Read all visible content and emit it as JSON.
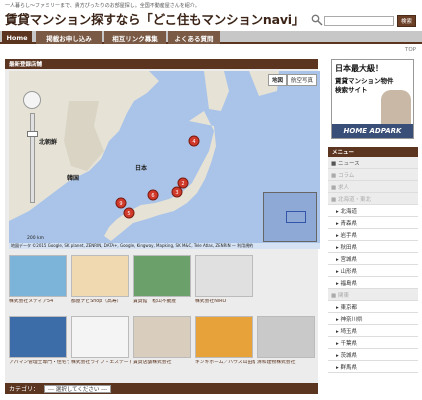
{
  "header": {
    "tagline": "一人暮らし〜ファミリーまで、貴方ぴったりのお部屋探し。全国不動産屋さんを紹介。",
    "title": "賃貸マンション探すなら「どこ住もマンションnavi」",
    "search_placeholder": "",
    "search_button": "検索"
  },
  "nav": {
    "items": [
      {
        "label": "Home",
        "active": true
      },
      {
        "label": "掲載お申し込み",
        "active": false
      },
      {
        "label": "相互リンク募集",
        "active": false
      },
      {
        "label": "よくある質問",
        "active": false
      }
    ]
  },
  "top_link": "TOP",
  "main": {
    "section_title": "最新登録店舗",
    "map": {
      "type_buttons": [
        "地図",
        "航空写真"
      ],
      "labels": [
        "北朝鮮",
        "韓国",
        "日本"
      ],
      "scale": "200 km",
      "footer": "地図データ ©2015 Google, SK planet, ZENRIN, DATA+, Google, Kingway, Mapking, SK M&C, Tele Atlas, ZENRIN — 利用規約"
    },
    "listings": [
      {
        "caption": "株式会社メディア54",
        "color": "#7bb3d9"
      },
      {
        "caption": "都屋ナビShop（高寿）",
        "color": "#f0d9b0"
      },
      {
        "caption": "賃貸館　松山不動産",
        "color": "#6ba06b"
      },
      {
        "caption": "株式会社NiRO",
        "color": "#e0e0e0"
      },
      {
        "caption": "アパマン管理士専門・住宅ライフプラス",
        "color": "#3d6da8"
      },
      {
        "caption": "株式会社ライフ・エステート",
        "color": "#f4f4f4"
      },
      {
        "caption": "賃貸店舗株式会社",
        "color": "#d9cdbd"
      },
      {
        "caption": "キンキホーム／ハウス山田駅前センター",
        "color": "#e8a23a"
      },
      {
        "caption": "清和建物株式会社",
        "color": "#c9c9c9"
      }
    ],
    "category_label": "カテゴリ：",
    "category_select": "--- 選択してください ---"
  },
  "ad": {
    "line1": "日本最大級！",
    "line2": "賃貸マンション物件",
    "line3": "検索サイト",
    "brand": "HOME ADPARK"
  },
  "side_menu": {
    "title": "メニュー",
    "items": [
      {
        "label": "ニュース",
        "kind": "top"
      },
      {
        "label": "コラム",
        "kind": "grey"
      },
      {
        "label": "求人",
        "kind": "grey"
      },
      {
        "label": "北海道・東北",
        "kind": "grey"
      },
      {
        "label": "北海道",
        "kind": "sub"
      },
      {
        "label": "青森県",
        "kind": "sub"
      },
      {
        "label": "岩手県",
        "kind": "sub"
      },
      {
        "label": "秋田県",
        "kind": "sub"
      },
      {
        "label": "宮城県",
        "kind": "sub"
      },
      {
        "label": "山形県",
        "kind": "sub"
      },
      {
        "label": "福島県",
        "kind": "sub"
      },
      {
        "label": "関東",
        "kind": "grey"
      },
      {
        "label": "東京都",
        "kind": "sub"
      },
      {
        "label": "神奈川県",
        "kind": "sub"
      },
      {
        "label": "埼玉県",
        "kind": "sub"
      },
      {
        "label": "千葉県",
        "kind": "sub"
      },
      {
        "label": "茨城県",
        "kind": "sub"
      },
      {
        "label": "群馬県",
        "kind": "sub"
      }
    ]
  },
  "colors": {
    "brand_brown": "#5c3520",
    "map_sea": "#a9c4e8",
    "marker_red": "#d03a2a"
  }
}
